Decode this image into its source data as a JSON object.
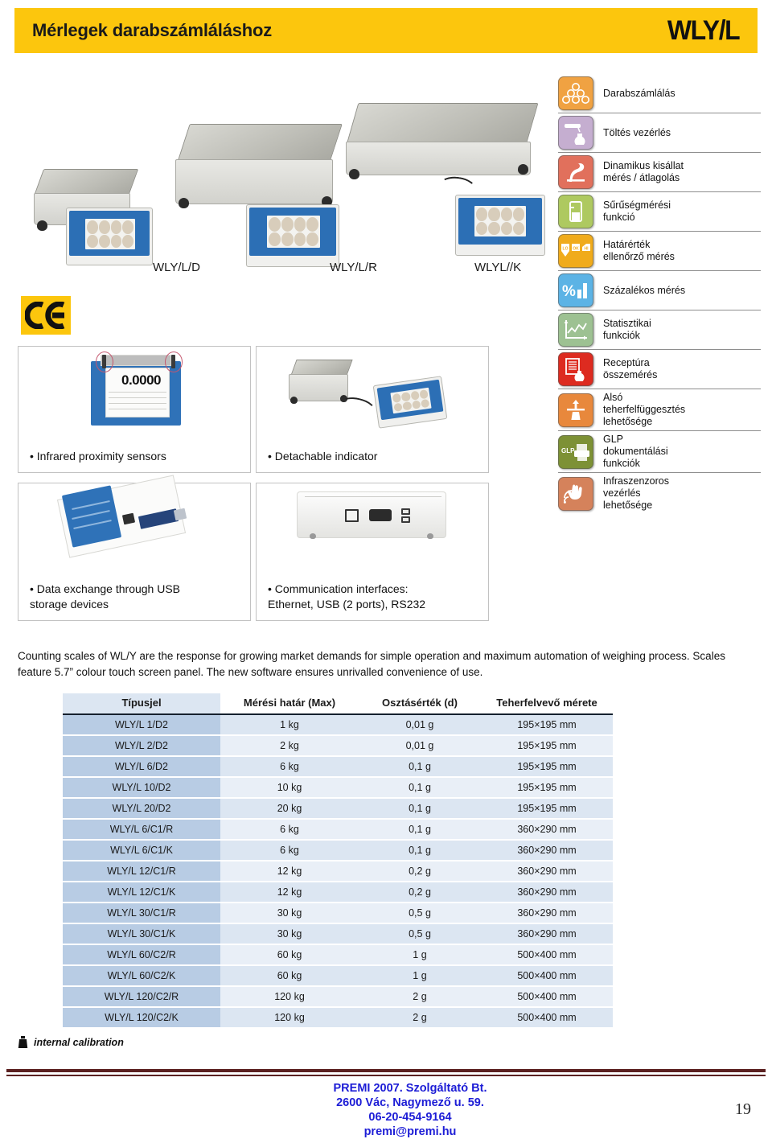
{
  "header": {
    "title": "Mérlegek darabszámláláshoz",
    "logo": "WLY/L",
    "band_color": "#fcc60d"
  },
  "hero": {
    "models": [
      {
        "label": "WLY/L/D"
      },
      {
        "label": "WLY/L/R"
      },
      {
        "label": "WLYL//K"
      }
    ]
  },
  "ce_mark": {
    "name": "CE"
  },
  "feature_boxes": [
    {
      "caption": "• Infrared proximity sensors",
      "art": "indicator-with-ir-sensors",
      "readout": "0.0000"
    },
    {
      "caption": "• Detachable  indicator",
      "art": "scale-with-detached-indicator"
    },
    {
      "caption": "• Data exchange through USB\nstorage devices",
      "art": "usb-stick-in-indicator"
    },
    {
      "caption": "• Communication interfaces:\nEthernet, USB (2 ports), RS232",
      "art": "rear-ports"
    }
  ],
  "features": [
    {
      "label": "Darabszámlálás",
      "icon": "piece-counting-icon",
      "color": "#f0a242"
    },
    {
      "label": "Töltés vezérlés",
      "icon": "filling-control-icon",
      "color": "#c5aed0"
    },
    {
      "label": "Dinamikus kisállat\nmérés / átlagolás",
      "icon": "animal-weighing-icon",
      "color": "#e1705c"
    },
    {
      "label": "Sűrűségmérési\nfunkció",
      "icon": "density-beaker-icon",
      "color": "#aec960"
    },
    {
      "label": "Határérték\nellenőrző mérés",
      "icon": "checkweighing-icon",
      "color": "#f0ab1b"
    },
    {
      "label": "Százalékos mérés",
      "icon": "percent-bars-icon",
      "color": "#5cb3e5"
    },
    {
      "label": "Statisztikai\nfunkciók",
      "icon": "statistics-chart-icon",
      "color": "#9dc192"
    },
    {
      "label": "Receptúra\nösszemérés",
      "icon": "formulation-icon",
      "color": "#dd2b20"
    },
    {
      "label": "Alsó\nteherfelfüggesztés\nlehetősége",
      "icon": "under-hook-icon",
      "color": "#e8883c"
    },
    {
      "label": "GLP\ndokumentálási\nfunkciók",
      "icon": "glp-printer-icon",
      "color": "#7d9135"
    },
    {
      "label": "Infraszenzoros\nvezérlés\nlehetősége",
      "icon": "infrared-hand-icon",
      "color": "#d5825b"
    }
  ],
  "description": "Counting scales of WL/Y are the response for growing market demands for simple operation and maximum automation of weighing process. Scales feature 5.7”  colour touch screen panel. The new software ensures unrivalled convenience of use.",
  "spec_table": {
    "columns": [
      "Típusjel",
      "Mérési határ (Max)",
      "Osztásérték (d)",
      "Teherfelvevő mérete"
    ],
    "rows": [
      [
        "WLY/L 1/D2",
        "1 kg",
        "0,01 g",
        "195×195 mm"
      ],
      [
        "WLY/L 2/D2",
        "2 kg",
        "0,01 g",
        "195×195 mm"
      ],
      [
        "WLY/L 6/D2",
        "6 kg",
        "0,1 g",
        "195×195 mm"
      ],
      [
        "WLY/L 10/D2",
        "10 kg",
        "0,1 g",
        "195×195 mm"
      ],
      [
        "WLY/L 20/D2",
        "20 kg",
        "0,1 g",
        "195×195 mm"
      ],
      [
        "WLY/L 6/C1/R",
        "6 kg",
        "0,1 g",
        "360×290 mm"
      ],
      [
        "WLY/L 6/C1/K",
        "6 kg",
        "0,1 g",
        "360×290 mm"
      ],
      [
        "WLY/L 12/C1/R",
        "12 kg",
        "0,2 g",
        "360×290 mm"
      ],
      [
        "WLY/L 12/C1/K",
        "12 kg",
        "0,2 g",
        "360×290 mm"
      ],
      [
        "WLY/L 30/C1/R",
        "30 kg",
        "0,5 g",
        "360×290 mm"
      ],
      [
        "WLY/L 30/C1/K",
        "30 kg",
        "0,5 g",
        "360×290 mm"
      ],
      [
        "WLY/L 60/C2/R",
        "60 kg",
        "1 g",
        "500×400 mm"
      ],
      [
        "WLY/L 60/C2/K",
        "60 kg",
        "1 g",
        "500×400 mm"
      ],
      [
        "WLY/L 120/C2/R",
        "120 kg",
        "2 g",
        "500×400 mm"
      ],
      [
        "WLY/L 120/C2/K",
        "120 kg",
        "2 g",
        "500×400 mm"
      ]
    ]
  },
  "footnote": "internal calibration",
  "footer": {
    "company": "PREMI 2007. Szolgáltató Bt.",
    "address": "2600 Vác, Nagymező u. 59.",
    "phone": "06-20-454-9164",
    "email": "premi@premi.hu",
    "page_number": "19",
    "text_color": "#1d1dd6",
    "rule_color": "#5c2222"
  }
}
